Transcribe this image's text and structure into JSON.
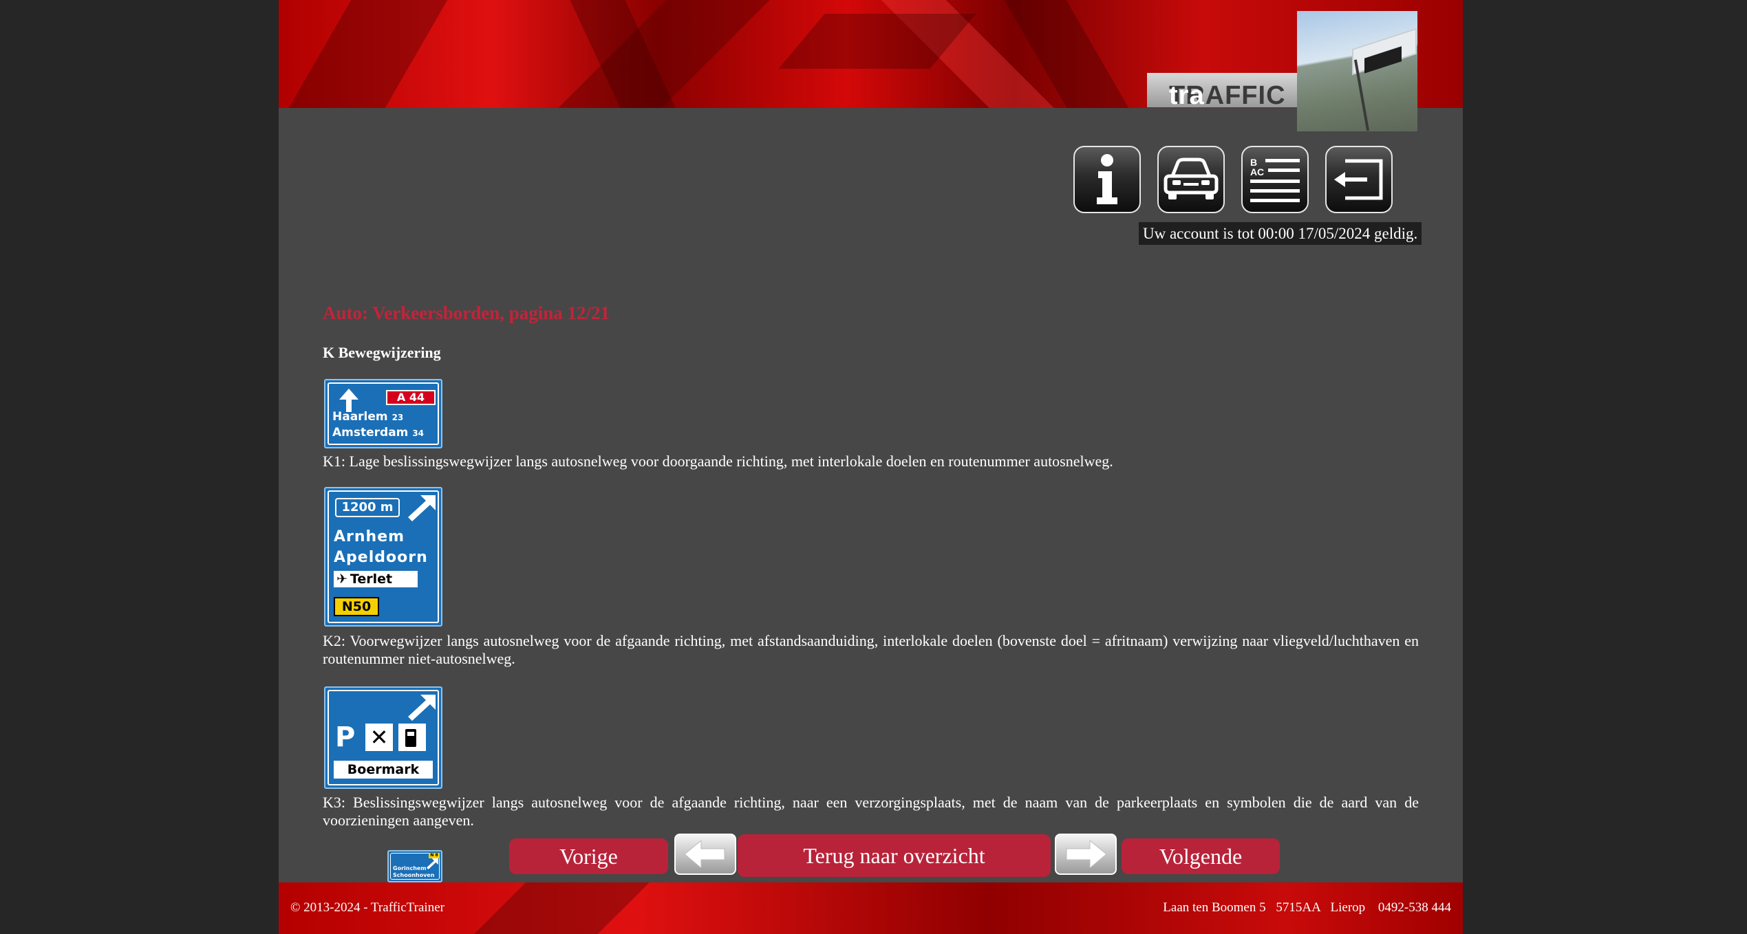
{
  "header": {
    "logo_text_dark": "TRAFFIC",
    "logo_text_light": "tra"
  },
  "toolbar": {
    "info_icon": "info-icon",
    "car_icon": "car-icon",
    "list_icon": "abc-list-icon",
    "logout_icon": "logout-icon"
  },
  "account": {
    "status": "Uw account is tot 00:00 17/05/2024 geldig."
  },
  "main": {
    "title": "Auto: Verkeersborden, pagina 12/21",
    "section": "K Bewegwijzering",
    "signs": [
      {
        "route_number": "A 44",
        "line1_city": "Haarlem",
        "line1_km": "23",
        "line2_city": "Amsterdam",
        "line2_km": "34",
        "description": "K1: Lage beslissingswegwijzer langs autosnelweg voor doorgaande richting, met interlokale doelen en routenummer autosnelweg."
      },
      {
        "distance": "1200 m",
        "city1": "Arnhem",
        "city2": "Apeldoorn",
        "airport": "Terlet",
        "route_number": "N50",
        "description": "K2: Voorwegwijzer langs autosnelweg voor de afgaande richting, met afstandsaanduiding, interlokale doelen (bovenste doel = afritnaam) verwijzing naar vliegveld/luchthaven en routenummer niet-autosnelweg."
      },
      {
        "parking_letter": "P",
        "place_name": "Boermark",
        "description": "K3: Beslissingswegwijzer langs autosnelweg voor de afgaande richting, naar een verzorgingsplaats, met de naam van de parkeerplaats en symbolen die de aard van de voorzieningen aangeven."
      },
      {
        "city1": "Gorinchem",
        "city2": "Schoonhoven",
        "route_number": "N 8"
      }
    ]
  },
  "navigation": {
    "prev_label": "Vorige",
    "overview_label": "Terug naar overzicht",
    "next_label": "Volgende"
  },
  "footer": {
    "copyright": "© 2013-2024 - TrafficTrainer",
    "street": "Laan ten Boomen 5",
    "postcode": "5715AA",
    "city": "Lierop",
    "phone": "0492-538 444"
  },
  "colors": {
    "accent_red": "#c2243a",
    "button_red": "#b8233a",
    "background": "#474747",
    "sign_blue": "#1a6fb7",
    "route_red": "#d4001e",
    "route_yellow": "#f5d000"
  }
}
